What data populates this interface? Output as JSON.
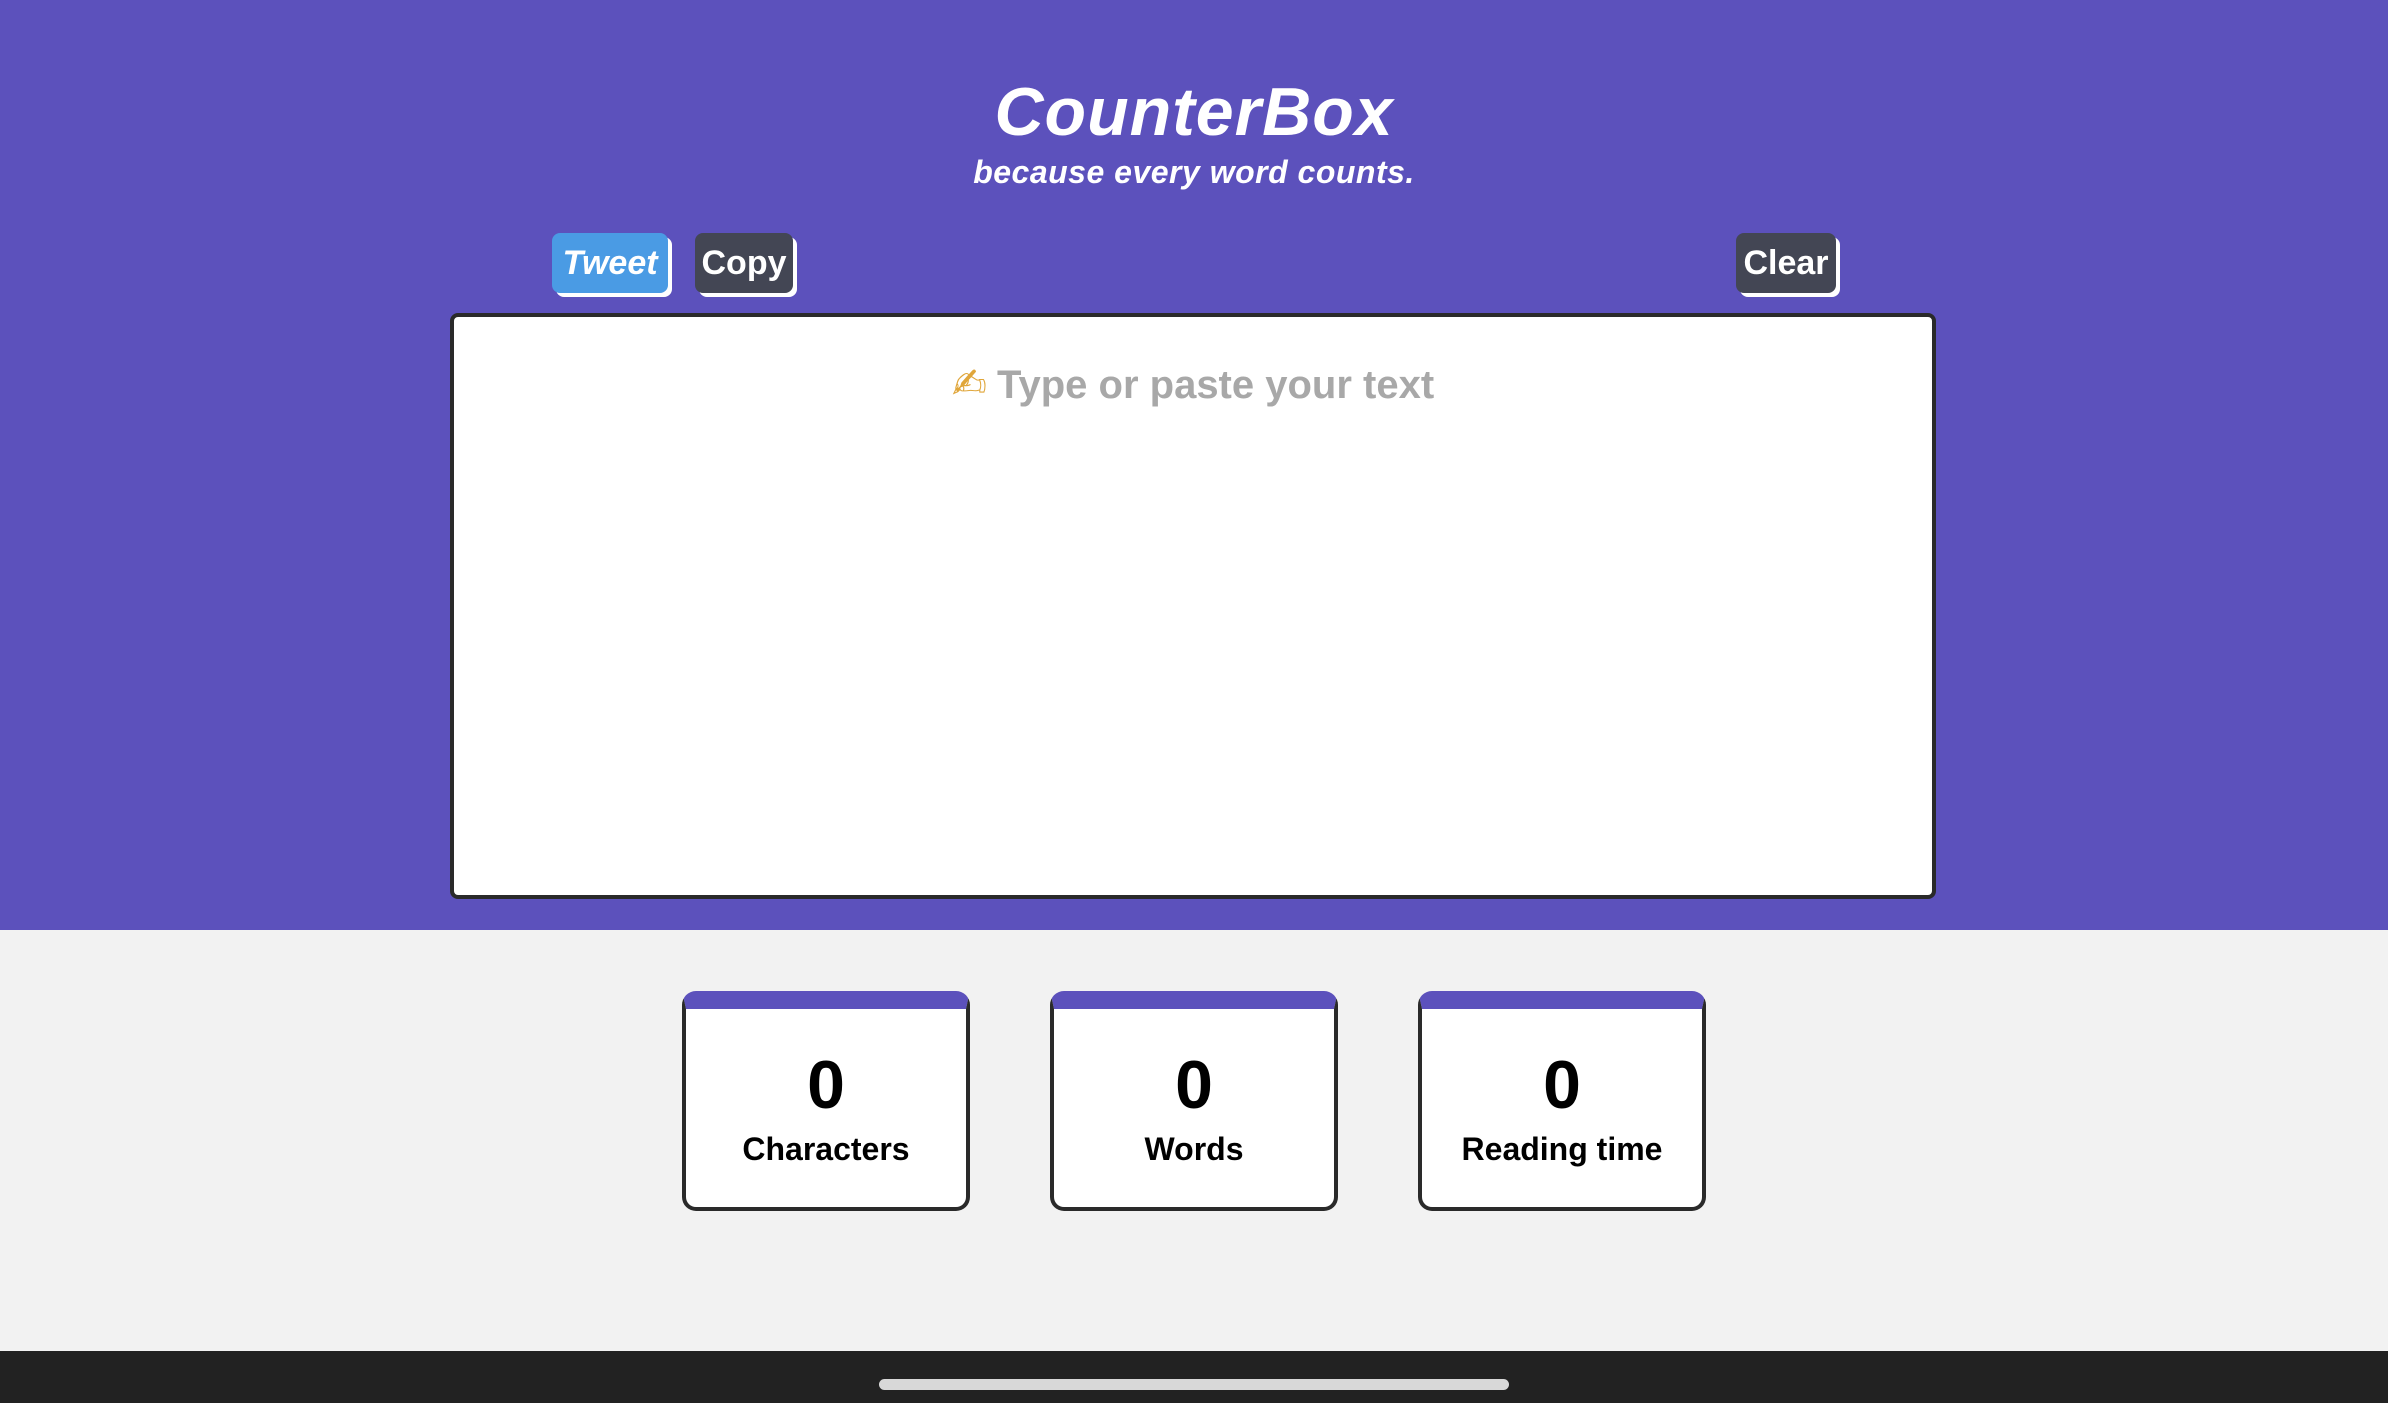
{
  "app": {
    "title": "CounterBox",
    "tagline": "because every word counts."
  },
  "toolbar": {
    "tweet_label": "Tweet",
    "copy_label": "Copy",
    "clear_label": "Clear"
  },
  "editor": {
    "icon": "writing-hand-icon",
    "icon_glyph": "✍",
    "placeholder": "Type or paste your text"
  },
  "stats": [
    {
      "value": "0",
      "label": "Characters"
    },
    {
      "value": "0",
      "label": "Words"
    },
    {
      "value": "0",
      "label": "Reading time"
    }
  ],
  "colors": {
    "brand": "#5c51bc",
    "tweet": "#4a9be4",
    "dark_button": "#434654",
    "background": "#f2f2f2"
  }
}
